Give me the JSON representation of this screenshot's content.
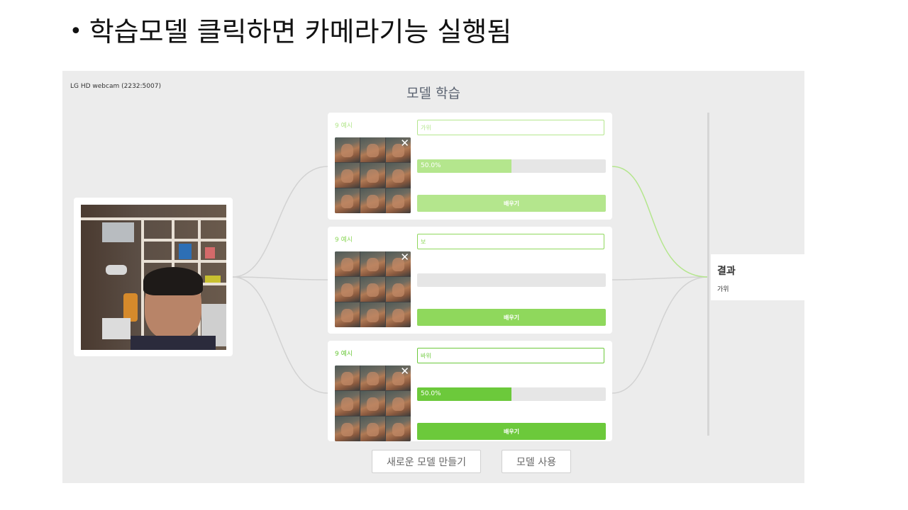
{
  "slide": {
    "bullet": "•",
    "title": "학습모델 클릭하면 카메라기능 실행됨"
  },
  "app": {
    "camera_label": "LG HD webcam (2232:5007)",
    "title": "모델 학습"
  },
  "classes": [
    {
      "examples_label": "9 예시",
      "name": "가위",
      "confidence": 0.5,
      "confidence_label": "50.0%",
      "train_label": "배우기",
      "color": "#b4e68d"
    },
    {
      "examples_label": "9 예시",
      "name": "보",
      "confidence": 0.0,
      "confidence_label": "",
      "train_label": "배우기",
      "color": "#8fd85c"
    },
    {
      "examples_label": "9 예시",
      "name": "바위",
      "confidence": 0.5,
      "confidence_label": "50.0%",
      "train_label": "배우기",
      "color": "#6cc93b"
    }
  ],
  "result": {
    "title": "결과",
    "value": "가위"
  },
  "footer": {
    "new_model_label": "새로운 모델 만들기",
    "use_model_label": "모델 사용"
  }
}
